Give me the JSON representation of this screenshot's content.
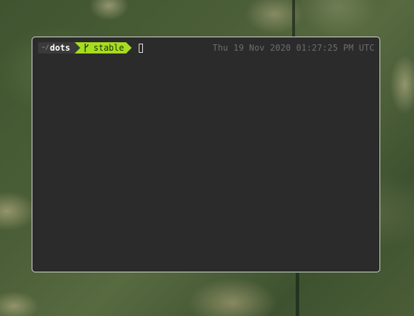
{
  "prompt": {
    "home_symbol": "~/",
    "directory": "dots",
    "branch_icon": "git-branch-icon",
    "branch": "stable"
  },
  "right_prompt": {
    "datetime": "Thu 19 Nov 2020 01:27:25 PM UTC"
  },
  "colors": {
    "terminal_bg": "#2b2b2b",
    "path_segment_bg": "#3a3a3a",
    "branch_segment_bg": "#a6de1e",
    "timestamp_text": "#6e6e6e"
  }
}
